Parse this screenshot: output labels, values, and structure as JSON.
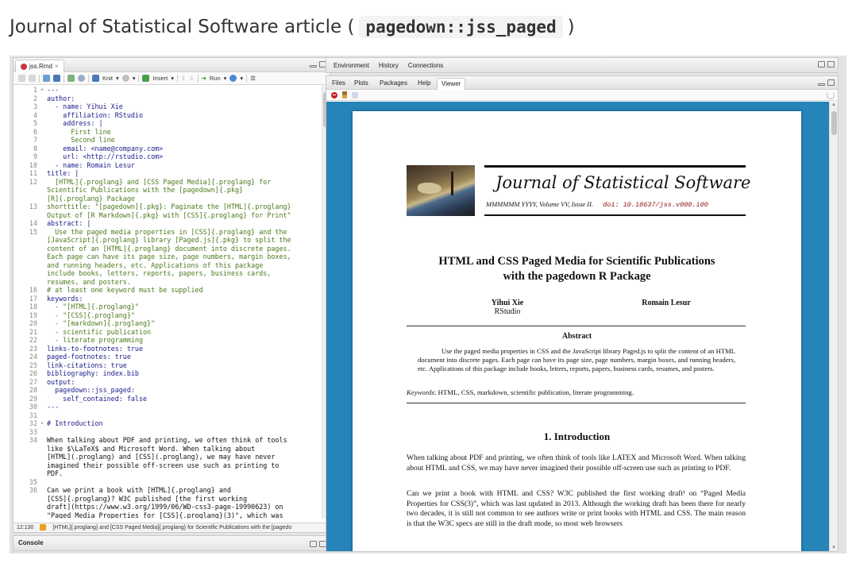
{
  "heading": {
    "prefix": "Journal of Statistical Software article (",
    "code": "pagedown::jss_paged",
    "suffix": ")"
  },
  "source_pane": {
    "tab_label": "jss.Rmd",
    "toolbar": {
      "knit_label": "Knit",
      "insert_label": "Insert",
      "run_label": "Run"
    },
    "lines": [
      {
        "n": "1",
        "fold": "▾",
        "text": "---",
        "cls": "key"
      },
      {
        "n": "2",
        "fold": "",
        "text": "author:",
        "cls": "key"
      },
      {
        "n": "3",
        "fold": "",
        "text": "  - name: Yihui Xie",
        "cls": "key"
      },
      {
        "n": "4",
        "fold": "",
        "text": "    affiliation: RStudio",
        "cls": "key"
      },
      {
        "n": "5",
        "fold": "",
        "text": "    address: |",
        "cls": "key"
      },
      {
        "n": "6",
        "fold": "",
        "text": "      First line",
        "cls": "str"
      },
      {
        "n": "7",
        "fold": "",
        "text": "      Second line",
        "cls": "str"
      },
      {
        "n": "8",
        "fold": "",
        "text": "    email: <name@company.com>",
        "cls": "key"
      },
      {
        "n": "9",
        "fold": "",
        "text": "    url: <http://rstudio.com>",
        "cls": "key"
      },
      {
        "n": "10",
        "fold": "",
        "text": "  - name: Romain Lesur",
        "cls": "key"
      },
      {
        "n": "11",
        "fold": "",
        "text": "title: |",
        "cls": "key"
      },
      {
        "n": "12",
        "fold": "",
        "text": "  [HTML]{.proglang} and [CSS Paged Media]{.proglang} for",
        "cls": "str"
      },
      {
        "n": "",
        "fold": "",
        "text": "Scientific Publications with the [pagedown]{.pkg}",
        "cls": "str"
      },
      {
        "n": "",
        "fold": "",
        "text": "[R]{.proglang} Package",
        "cls": "str"
      },
      {
        "n": "13",
        "fold": "",
        "text": "shorttitle: \"[pagedown]{.pkg}: Paginate the [HTML]{.proglang}",
        "cls": "str"
      },
      {
        "n": "",
        "fold": "",
        "text": "Output of [R Markdown]{.pkg} with [CSS]{.proglang} for Print\"",
        "cls": "str"
      },
      {
        "n": "14",
        "fold": "",
        "text": "abstract: |",
        "cls": "key"
      },
      {
        "n": "15",
        "fold": "",
        "text": "  Use the paged media properties in [CSS]{.proglang} and the",
        "cls": "str"
      },
      {
        "n": "",
        "fold": "",
        "text": "[JavaScript]{.proglang} library [Paged.js]{.pkg} to split the",
        "cls": "str"
      },
      {
        "n": "",
        "fold": "",
        "text": "content of an [HTML]{.proglang} document into discrete pages.",
        "cls": "str"
      },
      {
        "n": "",
        "fold": "",
        "text": "Each page can have its page size, page numbers, margin boxes,",
        "cls": "str"
      },
      {
        "n": "",
        "fold": "",
        "text": "and running headers, etc. Applications of this package",
        "cls": "str"
      },
      {
        "n": "",
        "fold": "",
        "text": "include books, letters, reports, papers, business cards,",
        "cls": "str"
      },
      {
        "n": "",
        "fold": "",
        "text": "resumes, and posters.",
        "cls": "str"
      },
      {
        "n": "16",
        "fold": "",
        "text": "# at least one keyword must be supplied",
        "cls": "cmt"
      },
      {
        "n": "17",
        "fold": "",
        "text": "keywords:",
        "cls": "key"
      },
      {
        "n": "18",
        "fold": "",
        "text": "  - \"[HTML]{.proglang}\"",
        "cls": "str"
      },
      {
        "n": "19",
        "fold": "",
        "text": "  - \"[CSS]{.proglang}\"",
        "cls": "str"
      },
      {
        "n": "20",
        "fold": "",
        "text": "  - \"[markdown]{.proglang}\"",
        "cls": "str"
      },
      {
        "n": "21",
        "fold": "",
        "text": "  - scientific publication",
        "cls": "str"
      },
      {
        "n": "22",
        "fold": "",
        "text": "  - literate programming",
        "cls": "str"
      },
      {
        "n": "23",
        "fold": "",
        "text": "links-to-footnotes: true",
        "cls": "key"
      },
      {
        "n": "24",
        "fold": "",
        "text": "paged-footnotes: true",
        "cls": "key"
      },
      {
        "n": "25",
        "fold": "",
        "text": "link-citations: true",
        "cls": "key"
      },
      {
        "n": "26",
        "fold": "",
        "text": "bibliography: index.bib",
        "cls": "key"
      },
      {
        "n": "27",
        "fold": "",
        "text": "output:",
        "cls": "key"
      },
      {
        "n": "28",
        "fold": "",
        "text": "  pagedown::jss_paged:",
        "cls": "key"
      },
      {
        "n": "29",
        "fold": "",
        "text": "    self_contained: false",
        "cls": "key"
      },
      {
        "n": "30",
        "fold": "",
        "text": "---",
        "cls": "key"
      },
      {
        "n": "31",
        "fold": "",
        "text": "",
        "cls": "plain"
      },
      {
        "n": "32",
        "fold": "▾",
        "text": "# Introduction",
        "cls": "head"
      },
      {
        "n": "33",
        "fold": "",
        "text": "",
        "cls": "plain"
      },
      {
        "n": "34",
        "fold": "",
        "text": "When talking about PDF and printing, we often think of tools",
        "cls": "plain"
      },
      {
        "n": "",
        "fold": "",
        "text": "like $\\LaTeX$ and Microsoft Word. When talking about",
        "cls": "plain"
      },
      {
        "n": "",
        "fold": "",
        "text": "[HTML](.proglang) and [CSS](.proglang), we may have never",
        "cls": "plain"
      },
      {
        "n": "",
        "fold": "",
        "text": "imagined their possible off-screen use such as printing to",
        "cls": "plain"
      },
      {
        "n": "",
        "fold": "",
        "text": "PDF.",
        "cls": "plain"
      },
      {
        "n": "35",
        "fold": "",
        "text": "",
        "cls": "plain"
      },
      {
        "n": "36",
        "fold": "",
        "text": "Can we print a book with [HTML]{.proglang} and",
        "cls": "plain"
      },
      {
        "n": "",
        "fold": "",
        "text": "[CSS]{.proglang}? W3C published [the first working",
        "cls": "plain"
      },
      {
        "n": "",
        "fold": "",
        "text": "draft](https://www.w3.org/1999/06/WD-css3-page-19990623) on",
        "cls": "plain"
      },
      {
        "n": "",
        "fold": "",
        "text": "\"Paged Media Properties for [CSS]{.proglang}(3)\", which was",
        "cls": "plain"
      }
    ],
    "status_position": "12:130",
    "status_text": "[HTML]{.proglang} and [CSS Paged Media]{.proglang} for Scientific Publications with the [pagedo"
  },
  "console_label": "Console",
  "env_tabs": [
    "Environment",
    "History",
    "Connections"
  ],
  "viewer_tabs": [
    "Files",
    "Plots",
    "Packages",
    "Help",
    "Viewer"
  ],
  "paper": {
    "journal_title": "Journal of Statistical Software",
    "issue_line": "MMMMMM YYYY, Volume VV, Issue II.",
    "doi": "doi: 10.18637/jss.v000.i00",
    "title_line1": "HTML and CSS Paged Media for Scientific Publications",
    "title_line2": "with the pagedown R Package",
    "author1_name": "Yihui Xie",
    "author1_affil": "RStudio",
    "author2_name": "Romain Lesur",
    "abstract_heading": "Abstract",
    "abstract_text": "Use the paged media properties in CSS and the JavaScript library Paged.js to split the content of an HTML document into discrete pages. Each page can have its page size, page numbers, margin boxes, and running headers, etc. Applications of this package include books, letters, reports, papers, business cards, resumes, and posters.",
    "keywords_label": "Keywords",
    "keywords_text": ": HTML, CSS, markdown, scientific publication, literate programming.",
    "section_heading": "1. Introduction",
    "para1": "When talking about PDF and printing, we often think of tools like LATEX and Microsoft Word. When talking about HTML and CSS, we may have never imagined their possible off-screen use such as printing to PDF.",
    "para2": "Can we print a book with HTML and CSS? W3C published the first working draft¹ on “Paged Media Properties for CSS(3)”, which was last updated in 2013. Although the working draft has been there for nearly two decades, it is still not common to see authors write or print books with HTML and CSS. The main reason is that the W3C specs are still in the draft mode, so most web browsers"
  }
}
